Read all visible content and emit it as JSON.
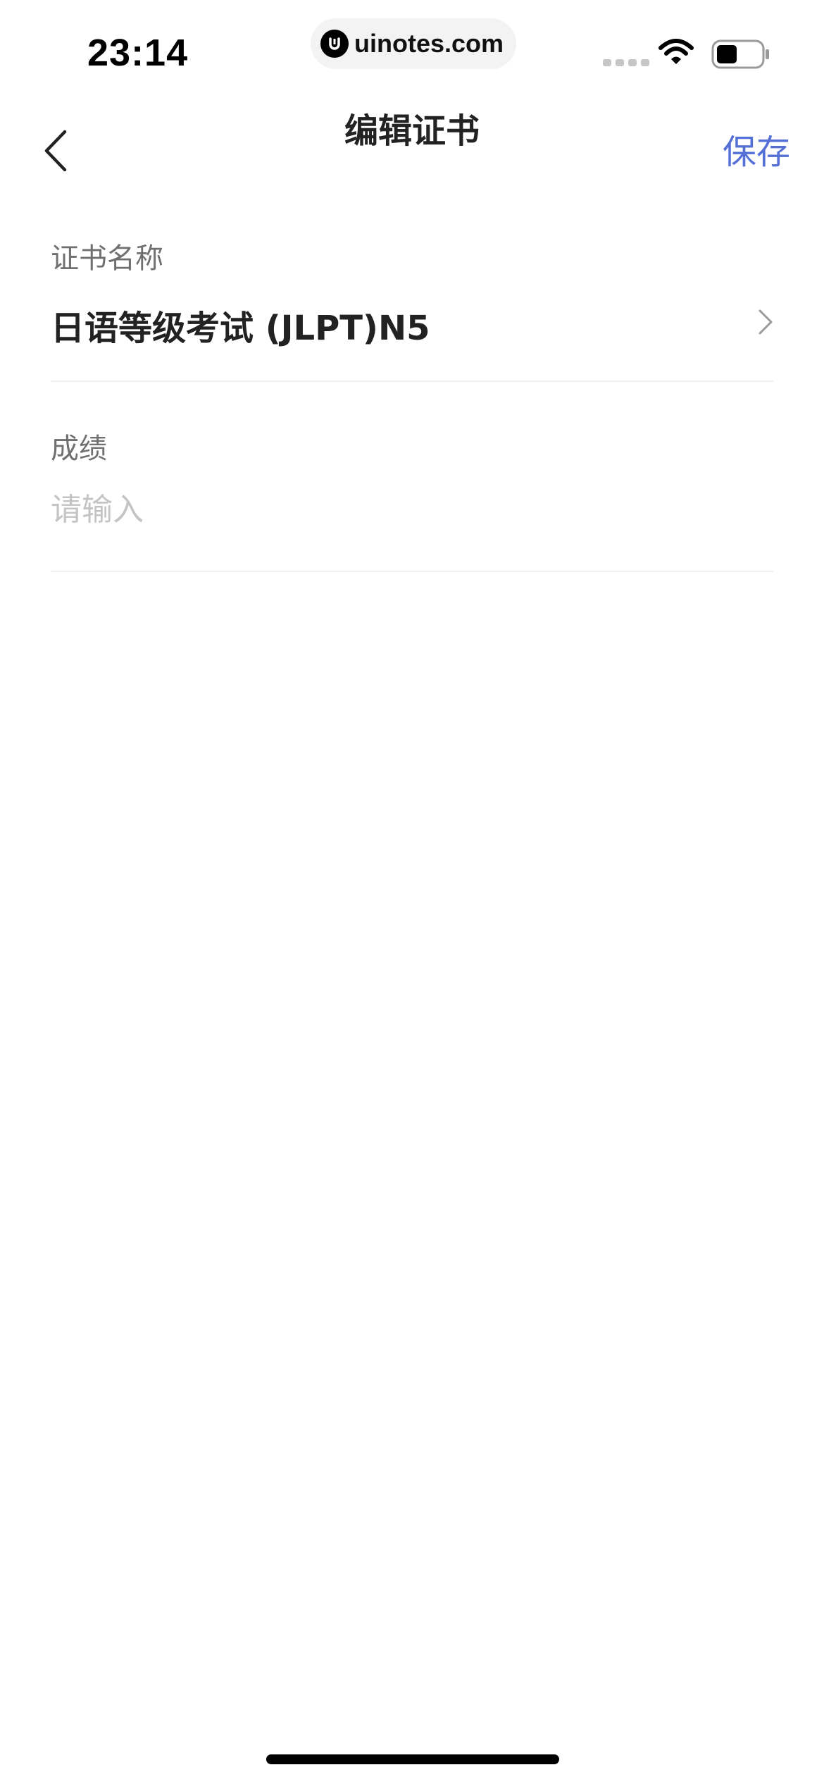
{
  "status_bar": {
    "time": "23:14",
    "url": "uinotes.com"
  },
  "nav": {
    "title": "编辑证书",
    "save_label": "保存"
  },
  "form": {
    "certificate": {
      "label": "证书名称",
      "value": "日语等级考试 (JLPT)N5"
    },
    "score": {
      "label": "成绩",
      "placeholder": "请输入",
      "value": ""
    }
  },
  "colors": {
    "accent": "#5470d6",
    "placeholder": "#c4c4c4"
  },
  "icons": [
    "back-arrow-icon",
    "chevron-right-icon",
    "wifi-icon",
    "battery-icon",
    "uinotes-logo-icon"
  ]
}
